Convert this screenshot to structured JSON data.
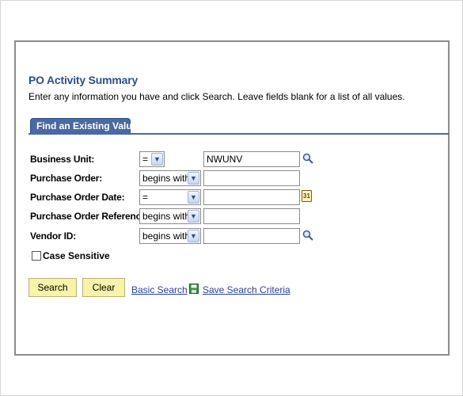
{
  "page": {
    "title": "PO Activity Summary",
    "instructions": "Enter any information you have and click Search. Leave fields blank for a list of all values."
  },
  "tab": {
    "label": "Find an Existing Value"
  },
  "fields": [
    {
      "label": "Business Unit:",
      "operator": "=",
      "value": "NWUNV",
      "icon": "lookup-icon"
    },
    {
      "label": "Purchase Order:",
      "operator": "begins with",
      "value": "",
      "icon": ""
    },
    {
      "label": "Purchase Order Date:",
      "operator": "=",
      "value": "",
      "icon": "calendar-icon"
    },
    {
      "label": "Purchase Order Reference:",
      "operator": "begins with",
      "value": "",
      "icon": ""
    },
    {
      "label": "Vendor ID:",
      "operator": "begins with",
      "value": "",
      "icon": "lookup-icon"
    }
  ],
  "calendar_icon_text": "31",
  "case_sensitive": {
    "label": "Case Sensitive",
    "checked": false
  },
  "buttons": {
    "search": "Search",
    "clear": "Clear"
  },
  "links": {
    "basic_search": "Basic Search",
    "save_search": "Save Search Criteria"
  },
  "colors": {
    "title": "#2c4f8a",
    "tab": "#4a69a3",
    "button": "#f7f3a8",
    "link": "#2a3fa0"
  }
}
